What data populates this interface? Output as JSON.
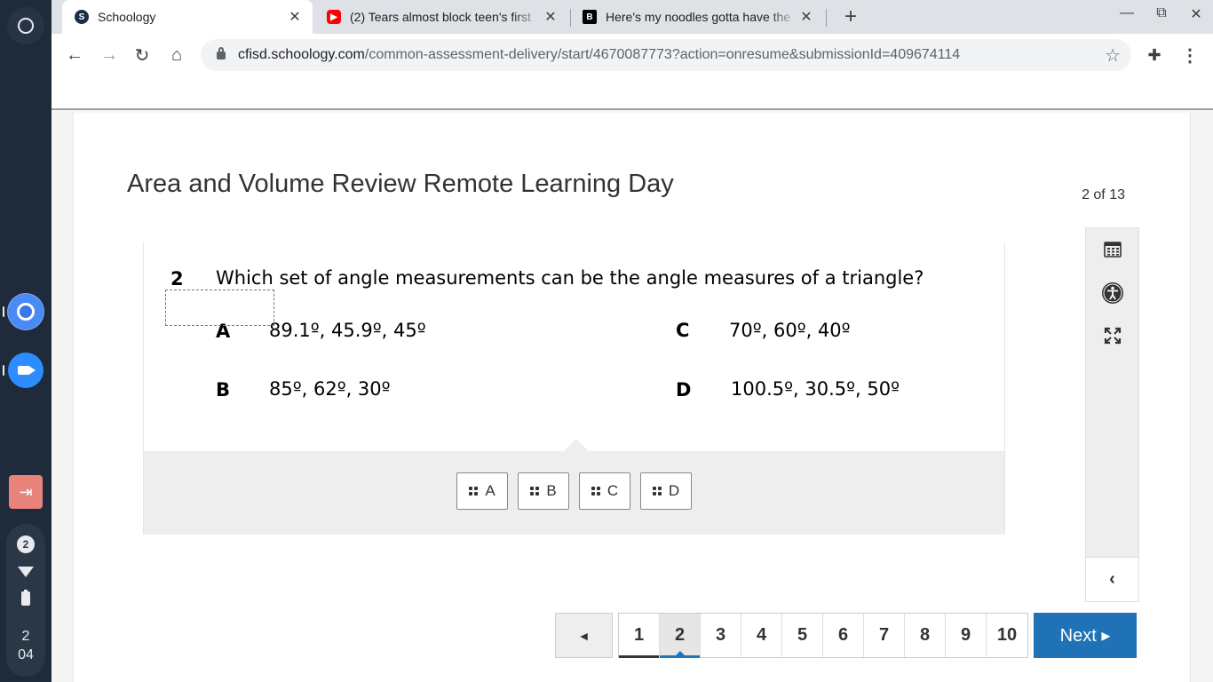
{
  "shelf": {
    "notification_count": "2",
    "clock_hour": "2",
    "clock_minute": "04"
  },
  "browser": {
    "tabs": [
      {
        "title": "Schoology",
        "favicon": "schoology-icon"
      },
      {
        "title": "(2) Tears almost block teen's first",
        "favicon": "youtube-icon"
      },
      {
        "title": "Here's my noodles gotta have the",
        "favicon": "bored-panda-icon"
      }
    ],
    "url_host": "cfisd.schoology.com",
    "url_path": "/common-assessment-delivery/start/4670087773?action=onresume&submissionId=409674114"
  },
  "assessment": {
    "title": "Area and Volume Review Remote Learning Day",
    "progress": "2 of 13"
  },
  "question": {
    "number": "2",
    "text": "Which set of angle measurements can be the angle measures of a triangle?",
    "options": [
      {
        "letter": "A",
        "text": "89.1º, 45.9º, 45º"
      },
      {
        "letter": "B",
        "text": "85º, 62º, 30º"
      },
      {
        "letter": "C",
        "text": "70º, 60º, 40º"
      },
      {
        "letter": "D",
        "text": "100.5º, 30.5º, 50º"
      }
    ],
    "choices": [
      "A",
      "B",
      "C",
      "D"
    ]
  },
  "pager": {
    "prev_label": "◄",
    "pages": [
      "1",
      "2",
      "3",
      "4",
      "5",
      "6",
      "7",
      "8",
      "9",
      "10"
    ],
    "current_page": "2",
    "next_label": "Next ▸"
  }
}
